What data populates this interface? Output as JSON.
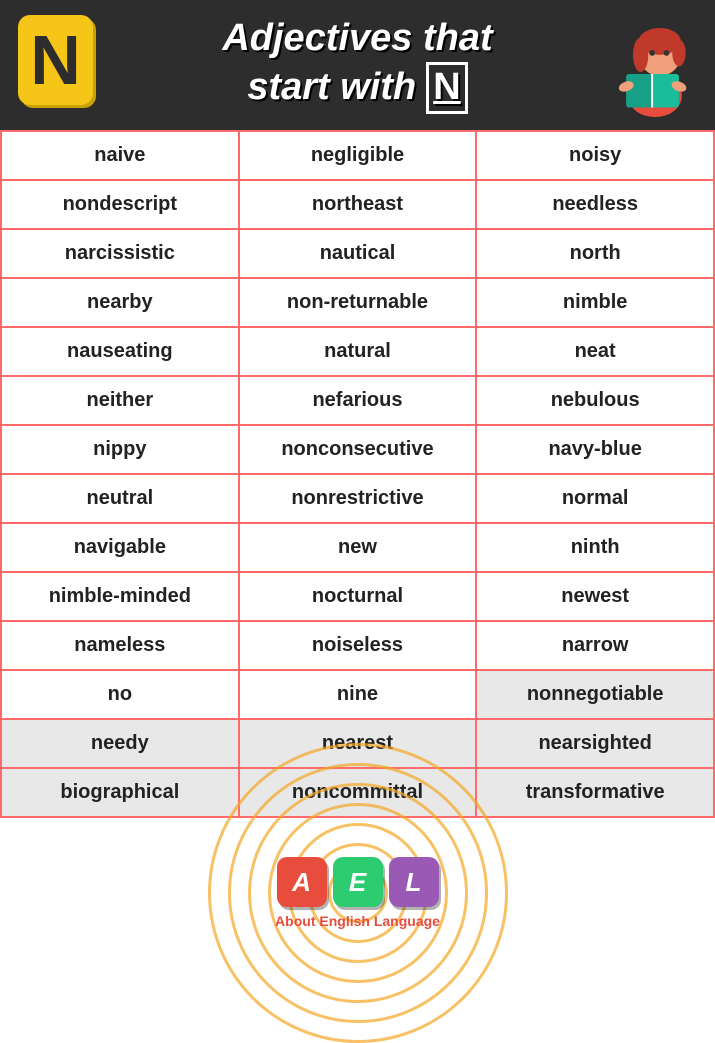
{
  "header": {
    "title_line1": "Adjectives that",
    "title_line2": "start with",
    "title_n": "N",
    "letter_display": "N"
  },
  "table": {
    "rows": [
      [
        "naive",
        "negligible",
        "noisy"
      ],
      [
        "nondescript",
        "northeast",
        "needless"
      ],
      [
        "narcissistic",
        "nautical",
        "north"
      ],
      [
        "nearby",
        "non-returnable",
        "nimble"
      ],
      [
        "nauseating",
        "natural",
        "neat"
      ],
      [
        "neither",
        "nefarious",
        "nebulous"
      ],
      [
        "nippy",
        "nonconsecutive",
        "navy-blue"
      ],
      [
        "neutral",
        "nonrestrictive",
        "normal"
      ],
      [
        "navigable",
        "new",
        "ninth"
      ],
      [
        "nimble-minded",
        "nocturnal",
        "newest"
      ],
      [
        "nameless",
        "noiseless",
        "narrow"
      ],
      [
        "no",
        "nine",
        "nonnegotiable"
      ],
      [
        "needy",
        "nearest",
        "nearsighted"
      ],
      [
        "biographical",
        "noncommittal",
        "transformative"
      ]
    ]
  },
  "footer": {
    "logo_a": "A",
    "logo_e": "E",
    "logo_l": "L",
    "brand_name": "About",
    "brand_highlight": "English",
    "brand_suffix": "Language"
  },
  "shaded_rows_start": 11
}
